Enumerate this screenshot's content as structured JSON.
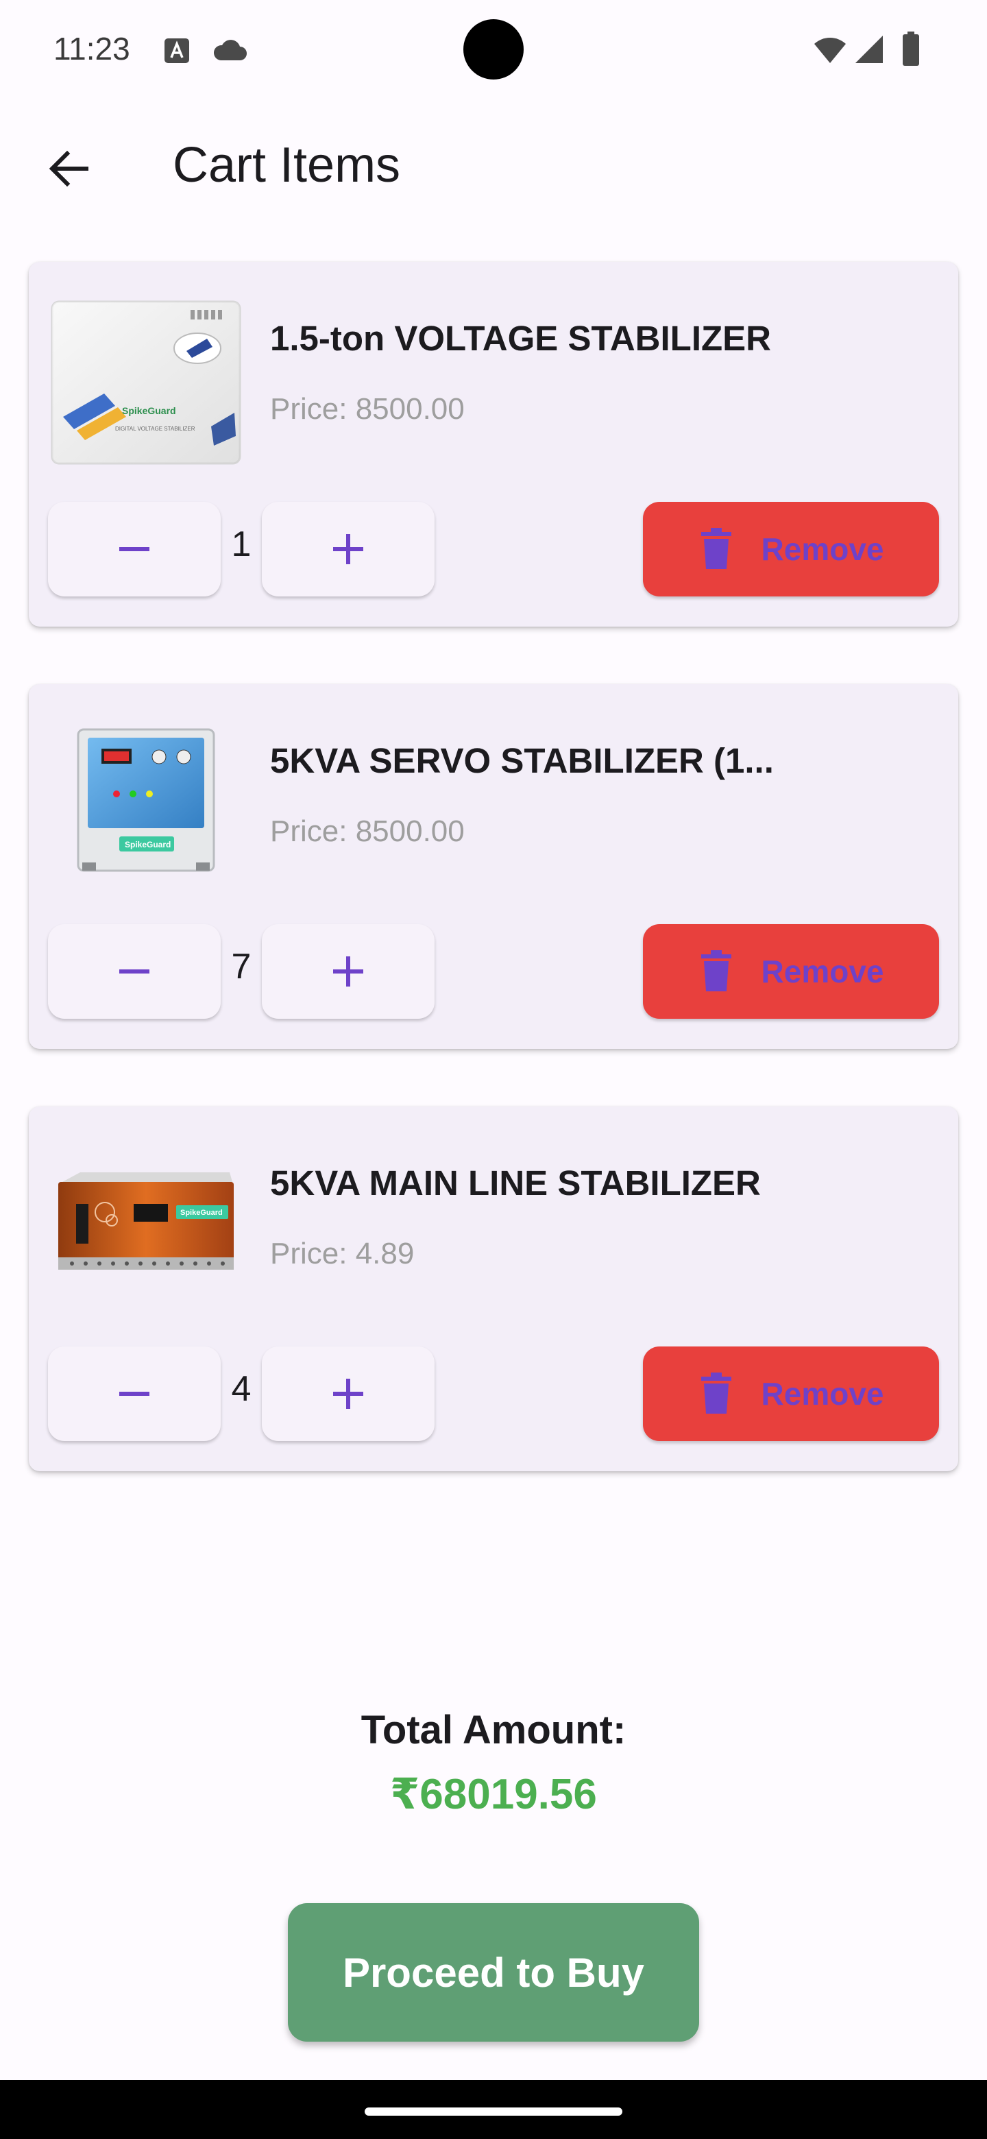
{
  "status_bar": {
    "time": "11:23"
  },
  "app_bar": {
    "title": "Cart Items"
  },
  "cart": {
    "items": [
      {
        "name": "1.5-ton VOLTAGE STABILIZER",
        "price": "Price: 8500.00",
        "quantity": "1",
        "remove_label": "Remove"
      },
      {
        "name": "5KVA SERVO STABILIZER (1...",
        "price": "Price: 8500.00",
        "quantity": "7",
        "remove_label": "Remove"
      },
      {
        "name": "5KVA MAIN LINE STABILIZER",
        "price": "Price: 4.89",
        "quantity": "4",
        "remove_label": "Remove"
      }
    ]
  },
  "summary": {
    "total_label": "Total Amount:",
    "total_value": "₹68019.56"
  },
  "actions": {
    "proceed_label": "Proceed to Buy"
  },
  "colors": {
    "accent": "#6e42c9",
    "remove": "#e8403d",
    "total": "#4caf50",
    "proceed": "#5f9f74",
    "card": "#f3eef8"
  }
}
